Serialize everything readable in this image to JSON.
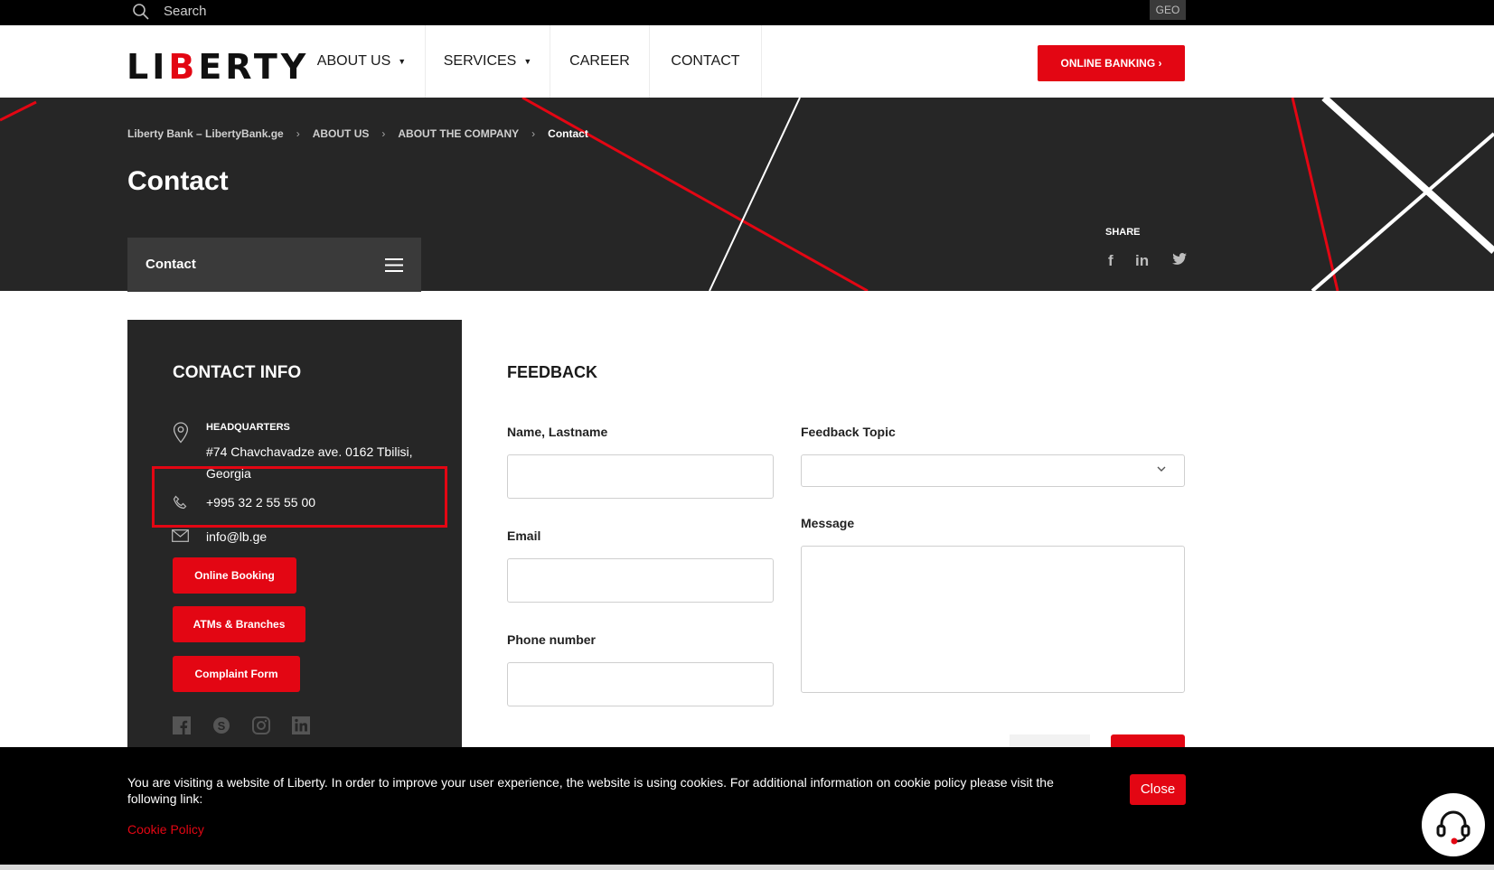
{
  "topbar": {
    "search_placeholder": "Search",
    "language": "GEO"
  },
  "header": {
    "logo_left": "LI",
    "logo_mid": "B",
    "logo_right": "ERTY",
    "nav": [
      {
        "label": "ABOUT US",
        "dropdown": true
      },
      {
        "label": "SERVICES",
        "dropdown": true
      },
      {
        "label": "CAREER",
        "dropdown": false
      },
      {
        "label": "CONTACT",
        "dropdown": false
      }
    ],
    "online_banking": "ONLINE BANKING"
  },
  "hero": {
    "breadcrumbs": [
      "Liberty Bank – LibertyBank.ge",
      "ABOUT US",
      "ABOUT THE COMPANY",
      "Contact"
    ],
    "title": "Contact",
    "side_menu_label": "Contact",
    "share_label": "SHARE",
    "share_icons": [
      "facebook-icon",
      "linkedin-icon",
      "twitter-icon"
    ]
  },
  "contact_info": {
    "title": "CONTACT INFO",
    "hq_label": "HEADQUARTERS",
    "hq_address": "#74 Chavchavadze ave. 0162 Tbilisi, Georgia",
    "phone": "+995 32 2 55 55 00",
    "email": "info@lb.ge",
    "buttons": [
      "Online Booking",
      "ATMs & Branches",
      "Complaint Form"
    ],
    "social_icons": [
      "facebook-icon",
      "skype-icon",
      "instagram-icon",
      "linkedin-icon"
    ]
  },
  "feedback": {
    "title": "FEEDBACK",
    "name_label": "Name, Lastname",
    "name_value": "",
    "email_label": "Email",
    "email_value": "",
    "phone_label": "Phone number",
    "phone_value": "",
    "topic_label": "Feedback Topic",
    "topic_value": "",
    "message_label": "Message",
    "message_value": ""
  },
  "cookie": {
    "text": "You are visiting a website of Liberty. In order to improve your user experience, the website is using cookies. For additional information on cookie policy please visit the following link:",
    "link": "Cookie Policy",
    "close": "Close"
  },
  "colors": {
    "brand_red": "#e30613",
    "dark": "#262626",
    "black": "#000000"
  }
}
